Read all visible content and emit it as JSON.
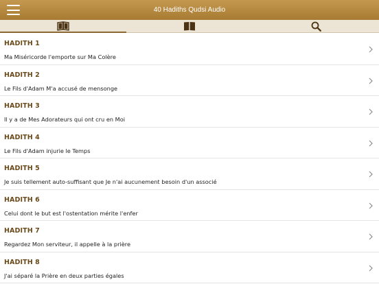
{
  "app": {
    "title": "40 Hadiths Qudsi Audio"
  },
  "tabs": [
    {
      "icon": "open-book-icon",
      "active": true
    },
    {
      "icon": "book-icon",
      "active": false
    },
    {
      "icon": "search-icon",
      "active": false
    }
  ],
  "hadiths": [
    {
      "title": "HADITH 1",
      "subtitle": "Ma Miséricorde l'emporte sur Ma Colère"
    },
    {
      "title": "HADITH 2",
      "subtitle": "Le Fils d'Adam M'a accusé de mensonge"
    },
    {
      "title": "HADITH 3",
      "subtitle": "Il y a de Mes Adorateurs qui ont cru en Moi"
    },
    {
      "title": "HADITH 4",
      "subtitle": "Le Fils d'Adam injurie le Temps"
    },
    {
      "title": "HADITH 5",
      "subtitle": "Je suis tellement auto-suffisant que Je n'ai aucunement besoin d'un associé"
    },
    {
      "title": "HADITH 6",
      "subtitle": "Celui dont le but est l'ostentation mérite l'enfer"
    },
    {
      "title": "HADITH 7",
      "subtitle": "Regardez Mon serviteur, il appelle à la prière"
    },
    {
      "title": "HADITH 8",
      "subtitle": "J'ai séparé la Prière en deux parties égales"
    }
  ],
  "colors": {
    "accent": "#a87a33",
    "title_text": "#6b4a1a",
    "tab_bg": "#ece5d6"
  }
}
